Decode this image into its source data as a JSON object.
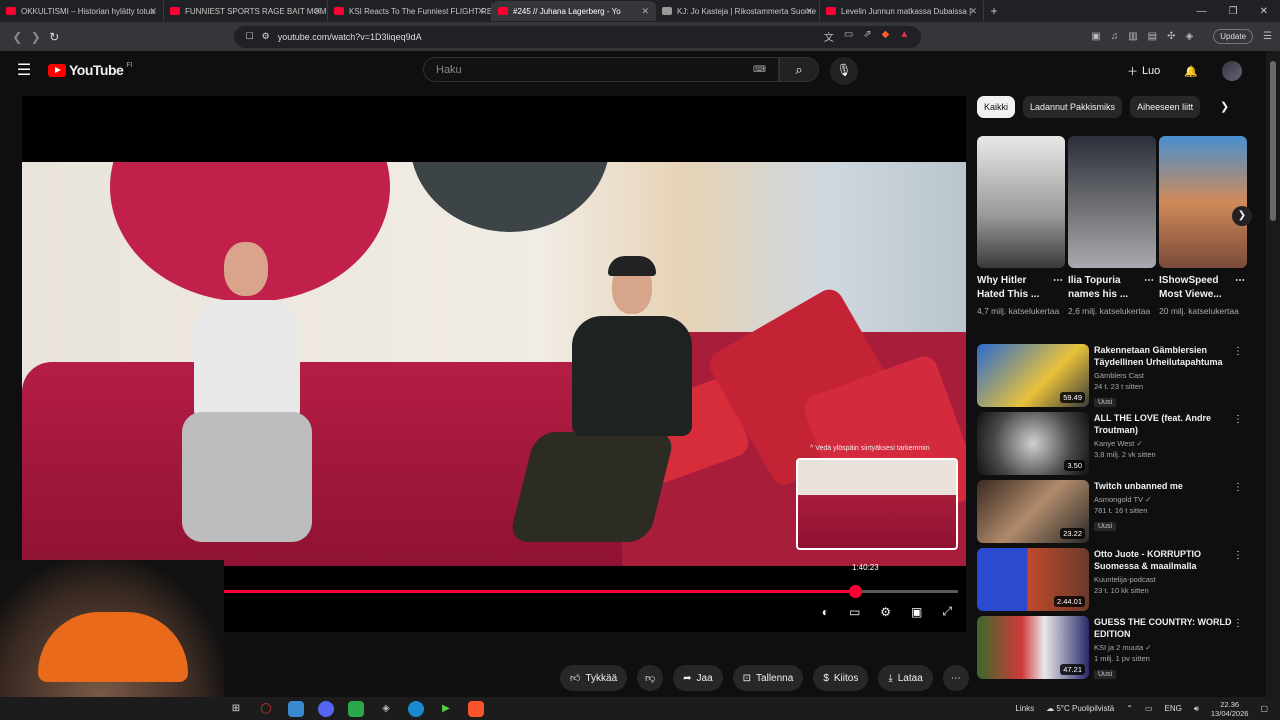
{
  "browser": {
    "tabs": [
      {
        "title": "OKKULTISMI – Historian hylätty totuu",
        "active": false,
        "favicon": "youtube"
      },
      {
        "title": "FUNNIEST SPORTS RAGE BAIT MOME",
        "active": false,
        "favicon": "youtube"
      },
      {
        "title": "KSI Reacts To The Funniest FLIGHT RE",
        "active": false,
        "favicon": "youtube"
      },
      {
        "title": "#245 // Juhana Lagerberg - Yo",
        "active": true,
        "favicon": "youtube"
      },
      {
        "title": "KJ: Jo Kasteja | Rikostammerta Suome",
        "active": false,
        "favicon": "page"
      },
      {
        "title": "Levelin Junnun matkassa Dubaissa |",
        "active": false,
        "favicon": "youtube"
      }
    ],
    "url": "youtube.com/watch?v=1D3liqeq9dA",
    "update_label": "Update"
  },
  "youtube": {
    "logo_text": "YouTube",
    "country_code": "FI",
    "search_placeholder": "Haku",
    "create_label": "Luo"
  },
  "player": {
    "seek_hint": "^ Vedä ylöspäin siirtyäksesi tarkemmin",
    "preview_time": "1:40:23",
    "progress_fraction": 0.889
  },
  "actions": {
    "like": "Tykkää",
    "share": "Jaa",
    "save": "Tallenna",
    "thanks": "Kiitos",
    "download": "Lataa"
  },
  "sidebar": {
    "chips": [
      "Kaikki",
      "Ladannut Pakkismiks",
      "Aiheeseen liitt"
    ],
    "shorts": [
      {
        "title": "Why Hitler Hated This ...",
        "views": "4,7 milj. katselukertaa"
      },
      {
        "title": "Ilia Topuria names his ...",
        "views": "2,6 milj. katselukertaa"
      },
      {
        "title": "IShowSpeed Most Viewe...",
        "views": "20 milj. katselukertaa"
      }
    ],
    "videos": [
      {
        "title": "Rakennetaan Gämblersien Täydellinen Urheilutapahtuma",
        "channel": "Gämblers Cast",
        "meta": "24 t.  23 t sitten",
        "badge": "Uusi",
        "duration": "59.49"
      },
      {
        "title": "ALL THE LOVE (feat. Andre Troutman)",
        "channel": "Kanye West ✓",
        "meta": "3,8 milj.  2 vk sitten",
        "badge": "",
        "duration": "3.50"
      },
      {
        "title": "Twitch unbanned me",
        "channel": "Asmongold TV ✓",
        "meta": "781 t.  16 t sitten",
        "badge": "Uusi",
        "duration": "23.22"
      },
      {
        "title": "Otto Juote - KORRUPTIO Suomessa & maailmalla",
        "channel": "Kuuntelija-podcast",
        "meta": "23 t.  10 kk sitten",
        "badge": "",
        "duration": "2.44.01"
      },
      {
        "title": "GUESS THE COUNTRY: WORLD EDITION",
        "channel": "KSI ja 2 muuta ✓",
        "meta": "1 milj.  1 pv sitten",
        "badge": "Uusi",
        "duration": "47.21"
      }
    ]
  },
  "taskbar": {
    "links_label": "Links",
    "weather": "5°C  Puolipilvistä",
    "lang": "ENG",
    "time": "22.36",
    "date": "13/04/2026"
  },
  "colors": {
    "accent": "#ff0033",
    "background": "#0f0f0f",
    "chip_selected": "#f1f1f1"
  }
}
